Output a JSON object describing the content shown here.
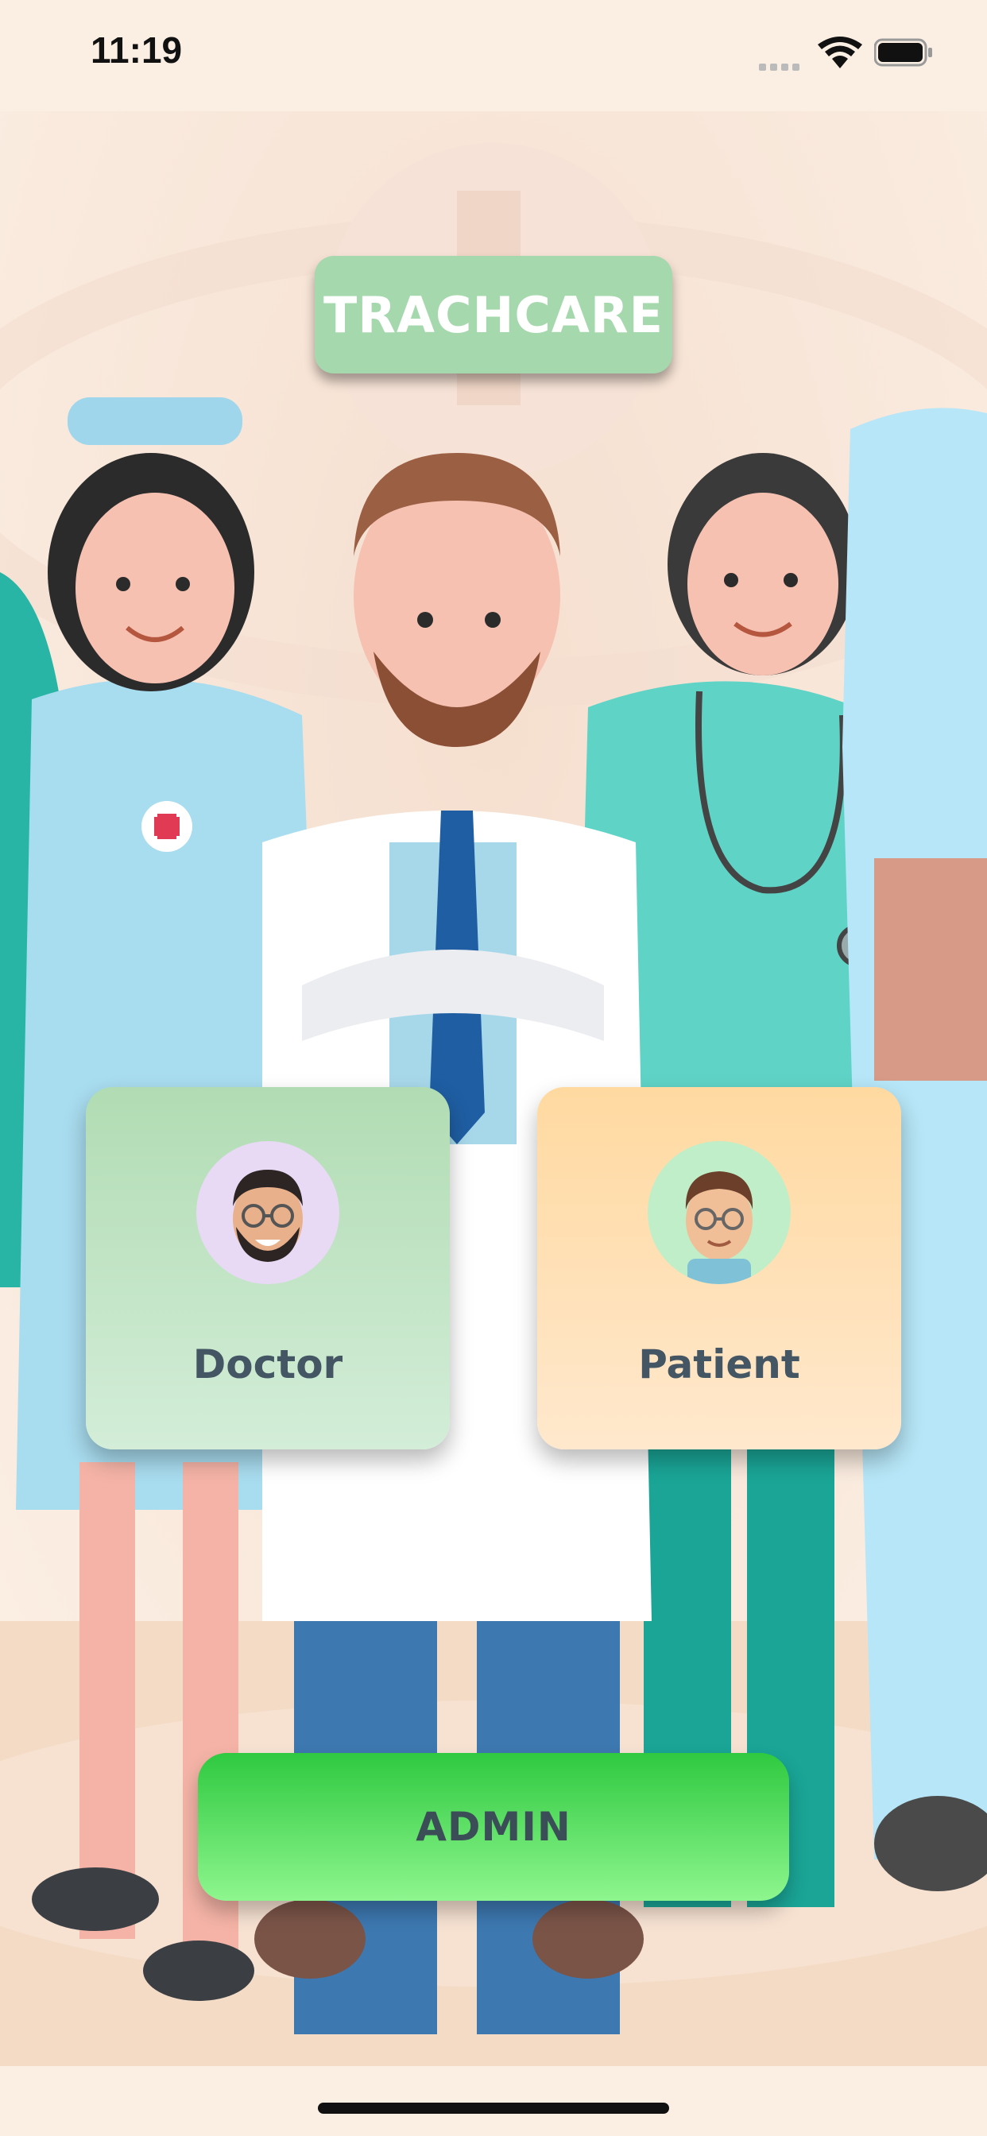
{
  "status_bar": {
    "time": "11:19"
  },
  "app": {
    "title": "TRACHCARE"
  },
  "roles": [
    {
      "label": "Doctor",
      "icon": "doctor-avatar-icon"
    },
    {
      "label": "Patient",
      "icon": "patient-avatar-icon"
    }
  ],
  "admin_button": {
    "label": "ADMIN"
  },
  "colors": {
    "title_badge": "#a5d8ac",
    "doctor_card": "#b1dcb3",
    "patient_card": "#ffd9a0",
    "admin_button": "#2fc940",
    "label_text": "#445563"
  }
}
